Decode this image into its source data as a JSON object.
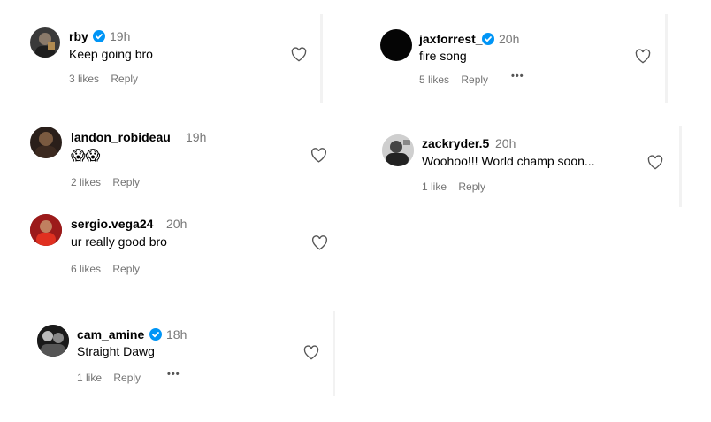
{
  "comments": [
    {
      "username": "rby",
      "verified": true,
      "time": "19h",
      "text": "Keep going bro",
      "likes": "3 likes",
      "reply": "Reply",
      "has_more": false
    },
    {
      "username": "jaxforrest_",
      "verified": true,
      "time": "20h",
      "text": "fire song",
      "likes": "5 likes",
      "reply": "Reply",
      "has_more": true,
      "more": "•••"
    },
    {
      "username": "landon_robideau",
      "verified": false,
      "time": "19h",
      "text": "😱😱",
      "likes": "2 likes",
      "reply": "Reply",
      "has_more": false
    },
    {
      "username": "zackryder.5",
      "verified": false,
      "time": "20h",
      "text": "Woohoo!!! World champ soon...",
      "likes": "1 like",
      "reply": "Reply",
      "has_more": false
    },
    {
      "username": "sergio.vega24",
      "verified": false,
      "time": "20h",
      "text": "ur really good bro",
      "likes": "6 likes",
      "reply": "Reply",
      "has_more": false
    },
    {
      "username": "cam_amine",
      "verified": true,
      "time": "18h",
      "text": "Straight Dawg",
      "likes": "1 like",
      "reply": "Reply",
      "has_more": true,
      "more": "•••"
    }
  ],
  "colors": {
    "verified_blue": "#0095f6",
    "meta_gray": "#737373",
    "emoji_yellow": "#f4b400"
  },
  "icons": {
    "like": "heart-icon",
    "verified": "verified-badge-icon",
    "more": "more-options-icon"
  }
}
